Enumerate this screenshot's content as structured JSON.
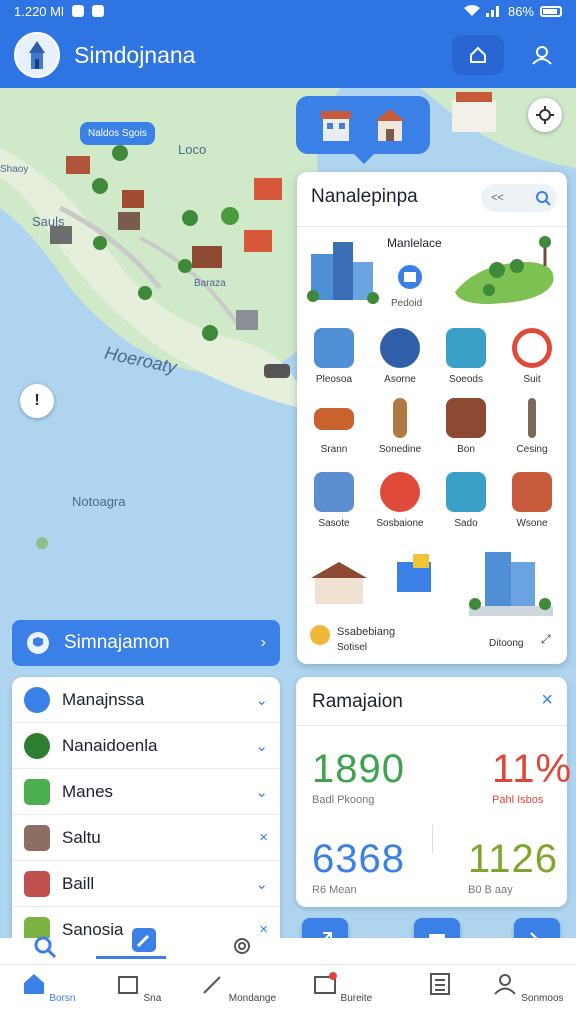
{
  "status": {
    "time": "1.220 Ml",
    "battery": "86%"
  },
  "app": {
    "title": "Simdojnana"
  },
  "map": {
    "labels": [
      "Loco",
      "Sauls",
      "Hoeroaty",
      "Notoagra",
      "Baraza",
      "Shaoy"
    ],
    "pill_label": "Naldos Sgois"
  },
  "panel": {
    "title": "Nanalepinpa",
    "search_placeholder": "<<",
    "featured": {
      "label": "Manlelace",
      "sub": "Pedoid"
    },
    "grid": [
      {
        "label": "Pleosoa"
      },
      {
        "label": "Asorne"
      },
      {
        "label": "Soeods"
      },
      {
        "label": "Suit"
      },
      {
        "label": "Srann"
      },
      {
        "label": "Sonedine"
      },
      {
        "label": "Bon"
      },
      {
        "label": "Cesing"
      },
      {
        "label": "Sasote"
      },
      {
        "label": "Sosbaione"
      },
      {
        "label": "Sado"
      },
      {
        "label": "Wsone"
      }
    ],
    "bottom": {
      "title": "Ssabebiang",
      "sub": "Sotisel",
      "right": "Ditoong"
    }
  },
  "section": {
    "label": "Simnajamon"
  },
  "list": [
    {
      "label": "Manajnssa",
      "color": "#3a80e6"
    },
    {
      "label": "Nanaidoenla",
      "color": "#2e7d32"
    },
    {
      "label": "Manes",
      "color": "#4caf50"
    },
    {
      "label": "Saltu",
      "color": "#8d6e63"
    },
    {
      "label": "Baill",
      "color": "#c0504d"
    },
    {
      "label": "Sanosia",
      "color": "#7cb342"
    }
  ],
  "stats": {
    "title": "Ramajaion",
    "items": [
      {
        "value": "1890",
        "label": "Badl Pkoong",
        "color": "#3fa34d"
      },
      {
        "value": "11%",
        "label": "Pahl Isbos",
        "color": "#e0453a"
      },
      {
        "value": "6368",
        "label": "R6 Mean",
        "color": "#3a80e6"
      },
      {
        "value": "1126",
        "label": "B0 B aay",
        "color": "#7fa52b"
      }
    ]
  },
  "nav": [
    {
      "label": "Borsn"
    },
    {
      "label": "Sna"
    },
    {
      "label": "Mondange"
    },
    {
      "label": "Bureite"
    },
    {
      "label": ""
    },
    {
      "label": "Sonmoos"
    }
  ]
}
